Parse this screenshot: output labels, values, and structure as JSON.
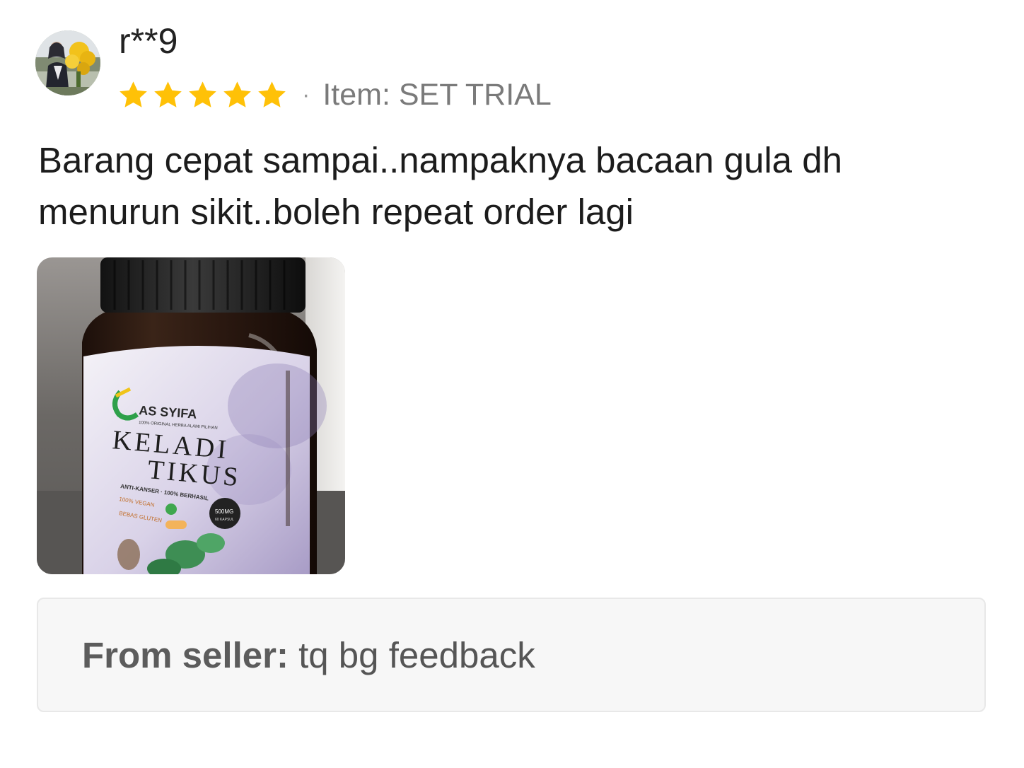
{
  "review": {
    "username": "r**9",
    "rating": 5,
    "rating_max": 5,
    "star_color": "#FFC107",
    "separator": "·",
    "item_variation": "Item: SET TRIAL",
    "comment": "Barang cepat sampai..nampaknya bacaan gula dh menurun sikit..boleh repeat order lagi",
    "photo": {
      "brand": "AS SYIFA",
      "tagline": "100% ORIGINAL HERBA ALAMI PILIHAN",
      "product_line1": "KELADI",
      "product_line2": "TIKUS",
      "claims": "ANTI-KANSER · 100% BERHASIL",
      "badge1": "100% VEGAN",
      "badge2": "BEBAS GLUTEN",
      "dose": "500MG",
      "dose_sub": "60 KAPSUL"
    }
  },
  "seller_reply": {
    "label": "From seller:",
    "text": "tq bg feedback"
  }
}
